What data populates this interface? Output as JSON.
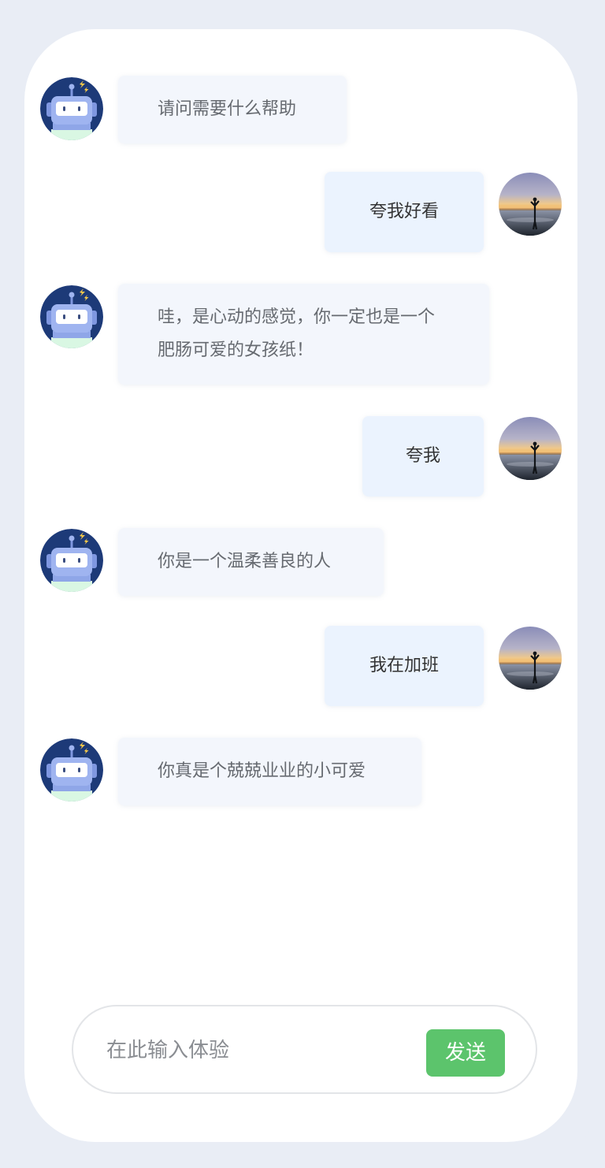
{
  "messages": [
    {
      "role": "bot",
      "text": "请问需要什么帮助"
    },
    {
      "role": "user",
      "text": "夸我好看"
    },
    {
      "role": "bot",
      "text": "哇，是心动的感觉，你一定也是一个肥肠可爱的女孩纸！"
    },
    {
      "role": "user",
      "text": "夸我"
    },
    {
      "role": "bot",
      "text": "你是一个温柔善良的人"
    },
    {
      "role": "user",
      "text": "我在加班"
    },
    {
      "role": "bot",
      "text": "你真是个兢兢业业的小可爱"
    }
  ],
  "composer": {
    "placeholder": "在此输入体验",
    "value": "",
    "send_label": "发送"
  },
  "icons": {
    "bot_avatar": "robot-avatar-icon",
    "user_avatar": "beach-sunset-avatar"
  },
  "colors": {
    "send_button": "#5cc46c",
    "bot_bubble": "#f3f6fc",
    "user_bubble": "#ebf3fe",
    "frame": "#e9edf5"
  }
}
